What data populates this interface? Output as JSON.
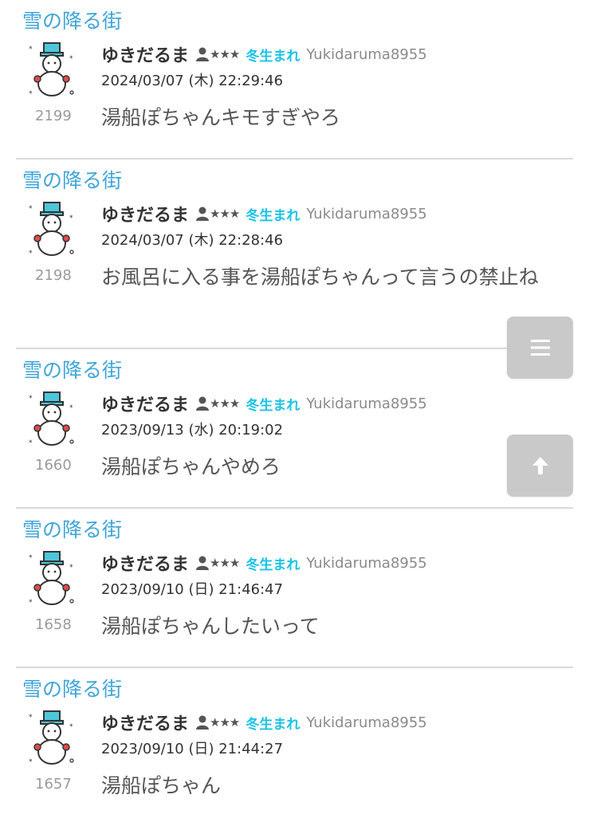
{
  "posts": [
    {
      "thread": "雪の降る街",
      "username": "ゆきだるま",
      "rank_stars": "★★★",
      "birth": "冬生まれ",
      "user_id": "Yukidaruma8955",
      "date": "2024/03/07 (木) 22:29:46",
      "number": "2199",
      "message": "湯船ぽちゃんキモすぎやろ"
    },
    {
      "thread": "雪の降る街",
      "username": "ゆきだるま",
      "rank_stars": "★★★",
      "birth": "冬生まれ",
      "user_id": "Yukidaruma8955",
      "date": "2024/03/07 (木) 22:28:46",
      "number": "2198",
      "message": "お風呂に入る事を湯船ぽちゃんって言うの禁止ね"
    },
    {
      "thread": "雪の降る街",
      "username": "ゆきだるま",
      "rank_stars": "★★★",
      "birth": "冬生まれ",
      "user_id": "Yukidaruma8955",
      "date": "2023/09/13 (水) 20:19:02",
      "number": "1660",
      "message": "湯船ぽちゃんやめろ"
    },
    {
      "thread": "雪の降る街",
      "username": "ゆきだるま",
      "rank_stars": "★★★",
      "birth": "冬生まれ",
      "user_id": "Yukidaruma8955",
      "date": "2023/09/10 (日) 21:46:47",
      "number": "1658",
      "message": "湯船ぽちゃんしたいって"
    },
    {
      "thread": "雪の降る街",
      "username": "ゆきだるま",
      "rank_stars": "★★★",
      "birth": "冬生まれ",
      "user_id": "Yukidaruma8955",
      "date": "2023/09/10 (日) 21:44:27",
      "number": "1657",
      "message": "湯船ぽちゃん"
    }
  ],
  "icons": {
    "avatar": "snowman-icon",
    "rank": "person-icon",
    "menu_button": "menu-icon",
    "top_button": "arrow-up-icon"
  },
  "colors": {
    "thread_link": "#3fa5d9",
    "birth_badge": "#19c3e6",
    "fab_background": "#c9c9c9"
  }
}
